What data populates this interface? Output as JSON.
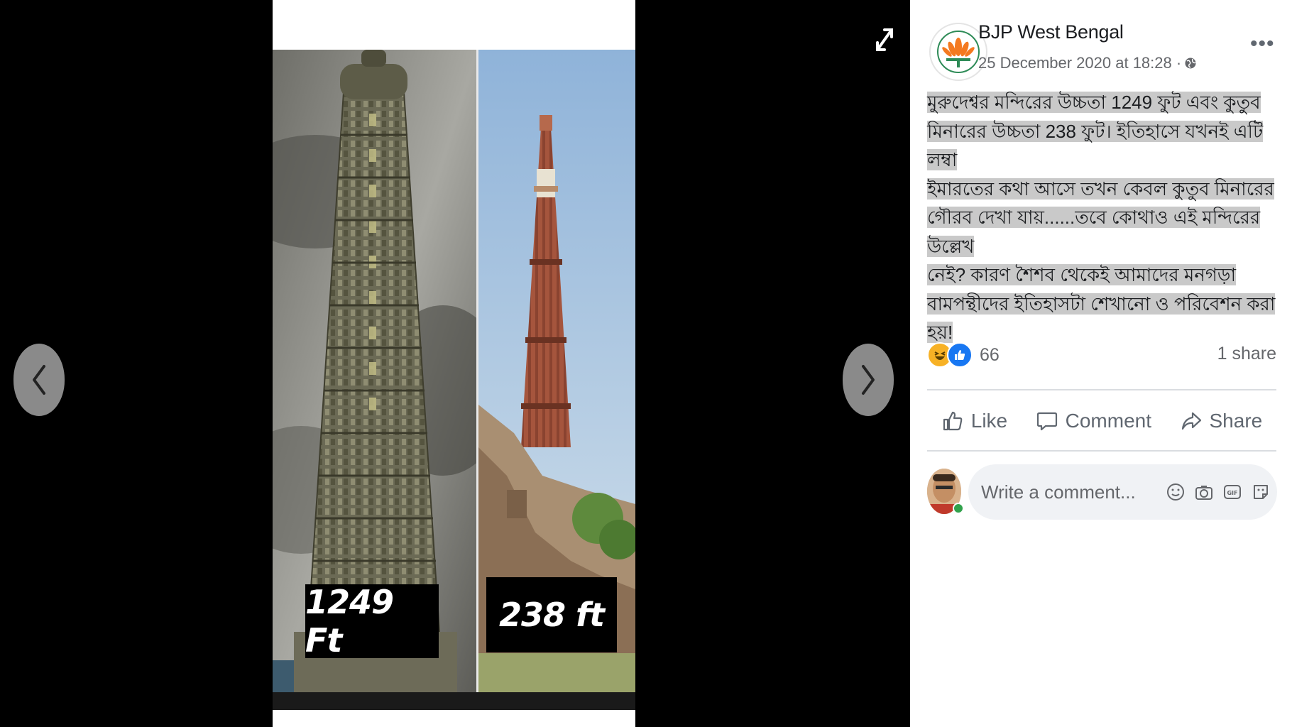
{
  "viewer": {
    "image": {
      "left_label": "1249 Ft",
      "right_label": "238 ft"
    },
    "prev_icon": "chevron-left-icon",
    "next_icon": "chevron-right-icon",
    "expand_icon": "expand-icon"
  },
  "post": {
    "page_name": "BJP West Bengal",
    "timestamp": "25 December 2020 at 18:28 ·",
    "text_lines": [
      "মুরুদেশ্বর মন্দিরের উচ্চতা 1249 ফুট এবং কুতুব",
      "মিনারের উচ্চতা 238 ফুট। ইতিহাসে যখনই এটি লম্বা",
      "ইমারতের কথা আসে তখন কেবল কুতুব মিনারের",
      "গৌরব দেখা যায়......তবে কোথাও এই মন্দিরের উল্লেখ",
      "নেই? কারণ শৈশব থেকেই আমাদের মনগড়া",
      "বামপন্থীদের ইতিহাসটা শেখানো ও পরিবেশন করা",
      "হয়!"
    ],
    "reactions": {
      "count": "66",
      "types": [
        "haha-reaction-icon",
        "like-reaction-icon"
      ]
    },
    "shares": "1 share",
    "actions": {
      "like": "Like",
      "comment": "Comment",
      "share": "Share"
    },
    "comment_placeholder": "Write a comment..."
  },
  "colors": {
    "facebook_blue": "#1877f2",
    "text_secondary": "#65676b",
    "highlight": "#c9c9c9"
  }
}
